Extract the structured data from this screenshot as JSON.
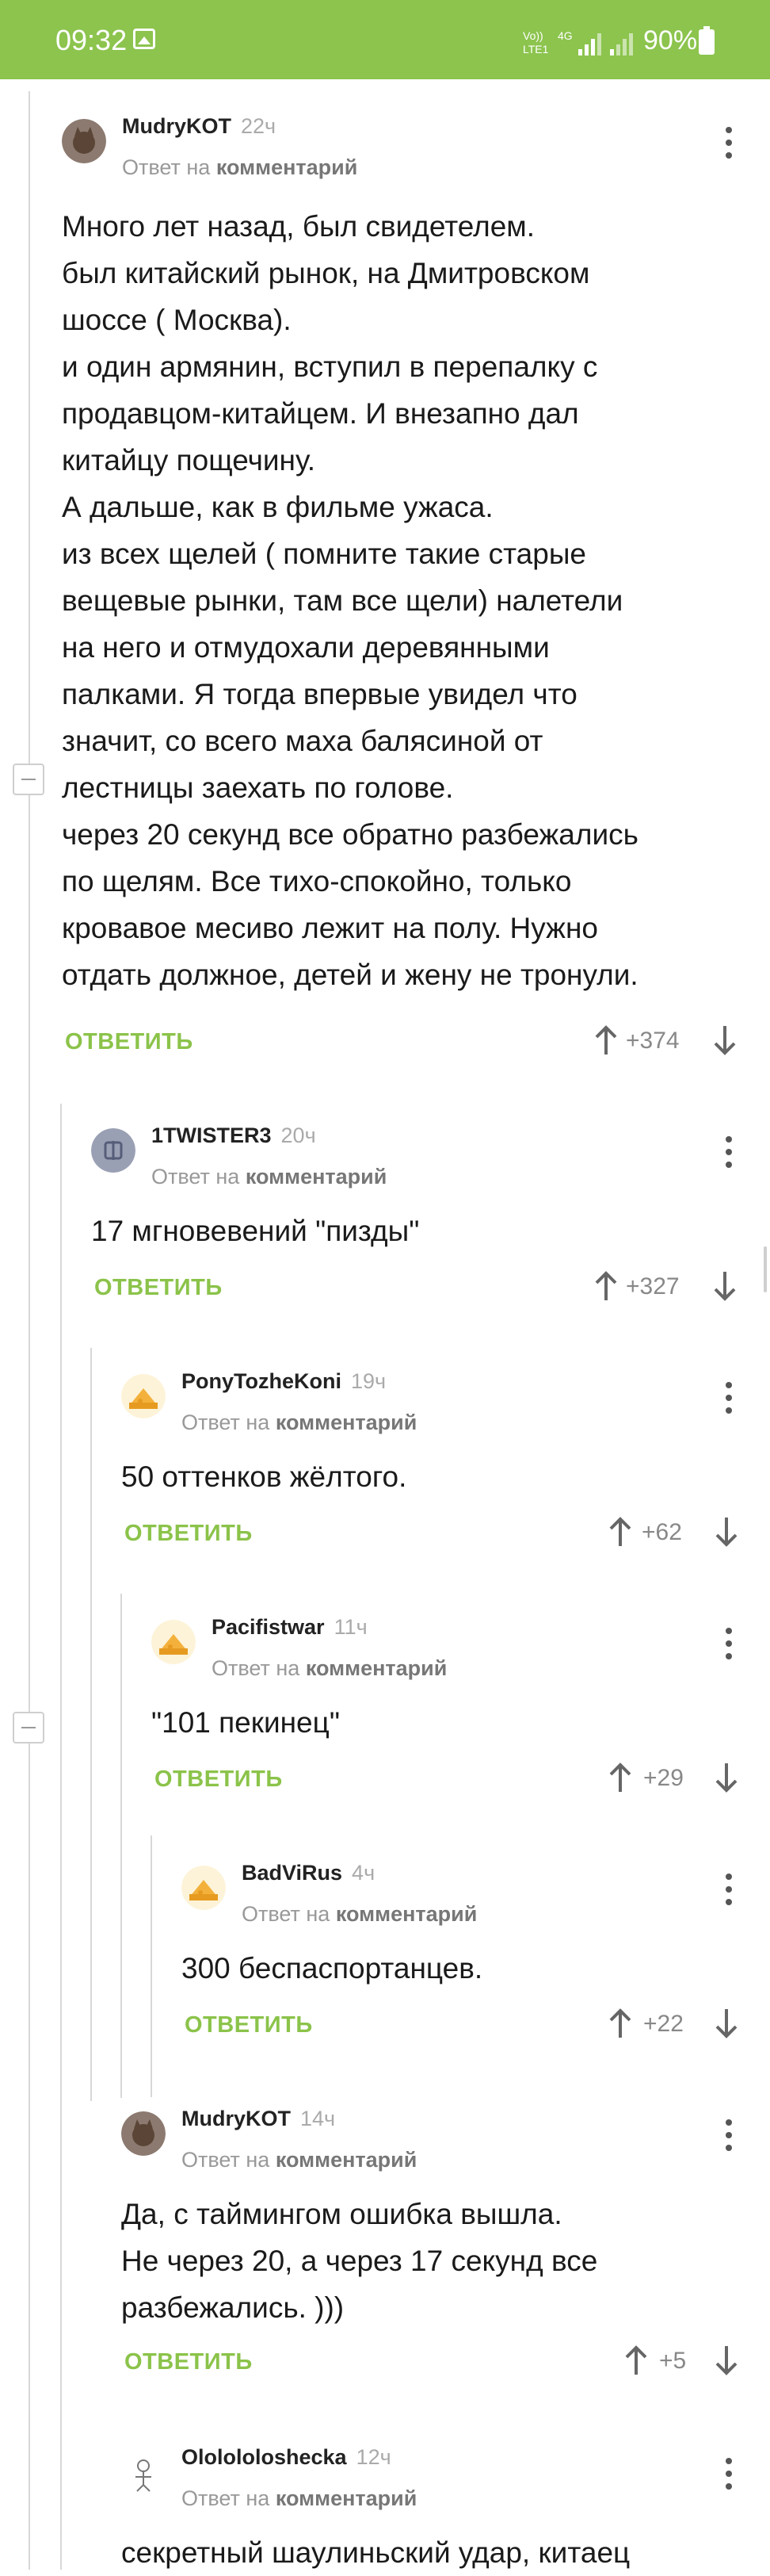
{
  "status_bar": {
    "time": "09:32",
    "network_top": "Vo))",
    "network_bottom": "LTE1",
    "net_type": "4G",
    "battery": "90%"
  },
  "ui": {
    "reply_prefix": "Ответ на",
    "reply_target": "комментарий",
    "reply_button": "ОТВЕТИТЬ"
  },
  "comments": [
    {
      "user": "MudryKOT",
      "time": "22ч",
      "lines": [
        "Много лет назад, был свидетелем.",
        "был китайский рынок, на Дмитровском",
        "шоссе ( Москва).",
        "и один армянин, вступил в перепалку с",
        "продавцом-китайцем. И внезапно дал",
        "китайцу пощечину.",
        "А дальше, как в фильме ужаса.",
        "из всех щелей ( помните такие старые",
        "вещевые рынки, там все щели) налетели",
        "на него и отмудохали деревянными",
        "палками. Я тогда впервые увидел что",
        "значит, со всего маха балясиной от",
        "лестницы заехать по голове.",
        "через 20 секунд все обратно разбежались",
        "по щелям. Все тихо-спокойно, только",
        "кровавое месиво лежит на полу. Нужно",
        "отдать должное, детей и жену не тронули."
      ],
      "score": "+374"
    },
    {
      "user": "1TWISTER3",
      "time": "20ч",
      "lines": [
        "17 мгновевений \"пизды\""
      ],
      "score": "+327"
    },
    {
      "user": "PonyTozheKoni",
      "time": "19ч",
      "lines": [
        "50 оттенков жёлтого."
      ],
      "score": "+62"
    },
    {
      "user": "Pacifistwar",
      "time": "11ч",
      "lines": [
        "\"101 пекинец\""
      ],
      "score": "+29"
    },
    {
      "user": "BadViRus",
      "time": "4ч",
      "lines": [
        "300 беспаспортанцев."
      ],
      "score": "+22"
    },
    {
      "user": "MudryKOT",
      "time": "14ч",
      "lines": [
        "Да, с таймингом ошибка вышла.",
        "Не через 20, а через 17 секунд все",
        "разбежались. )))"
      ],
      "score": "+5"
    },
    {
      "user": "Ololololoshecka",
      "time": "12ч",
      "lines": [
        "секретный шаулиньский удар, китаец"
      ],
      "score": ""
    }
  ],
  "colors": {
    "accent": "#8bc34a",
    "statusbar": "#8cc44e",
    "muted": "#999999"
  },
  "icons": [
    "gallery-icon",
    "signal-icon",
    "battery-icon",
    "kebab-icon",
    "arrow-up-icon",
    "arrow-down-icon",
    "collapse-icon",
    "avatar-cat-icon",
    "avatar-cheese-icon"
  ]
}
